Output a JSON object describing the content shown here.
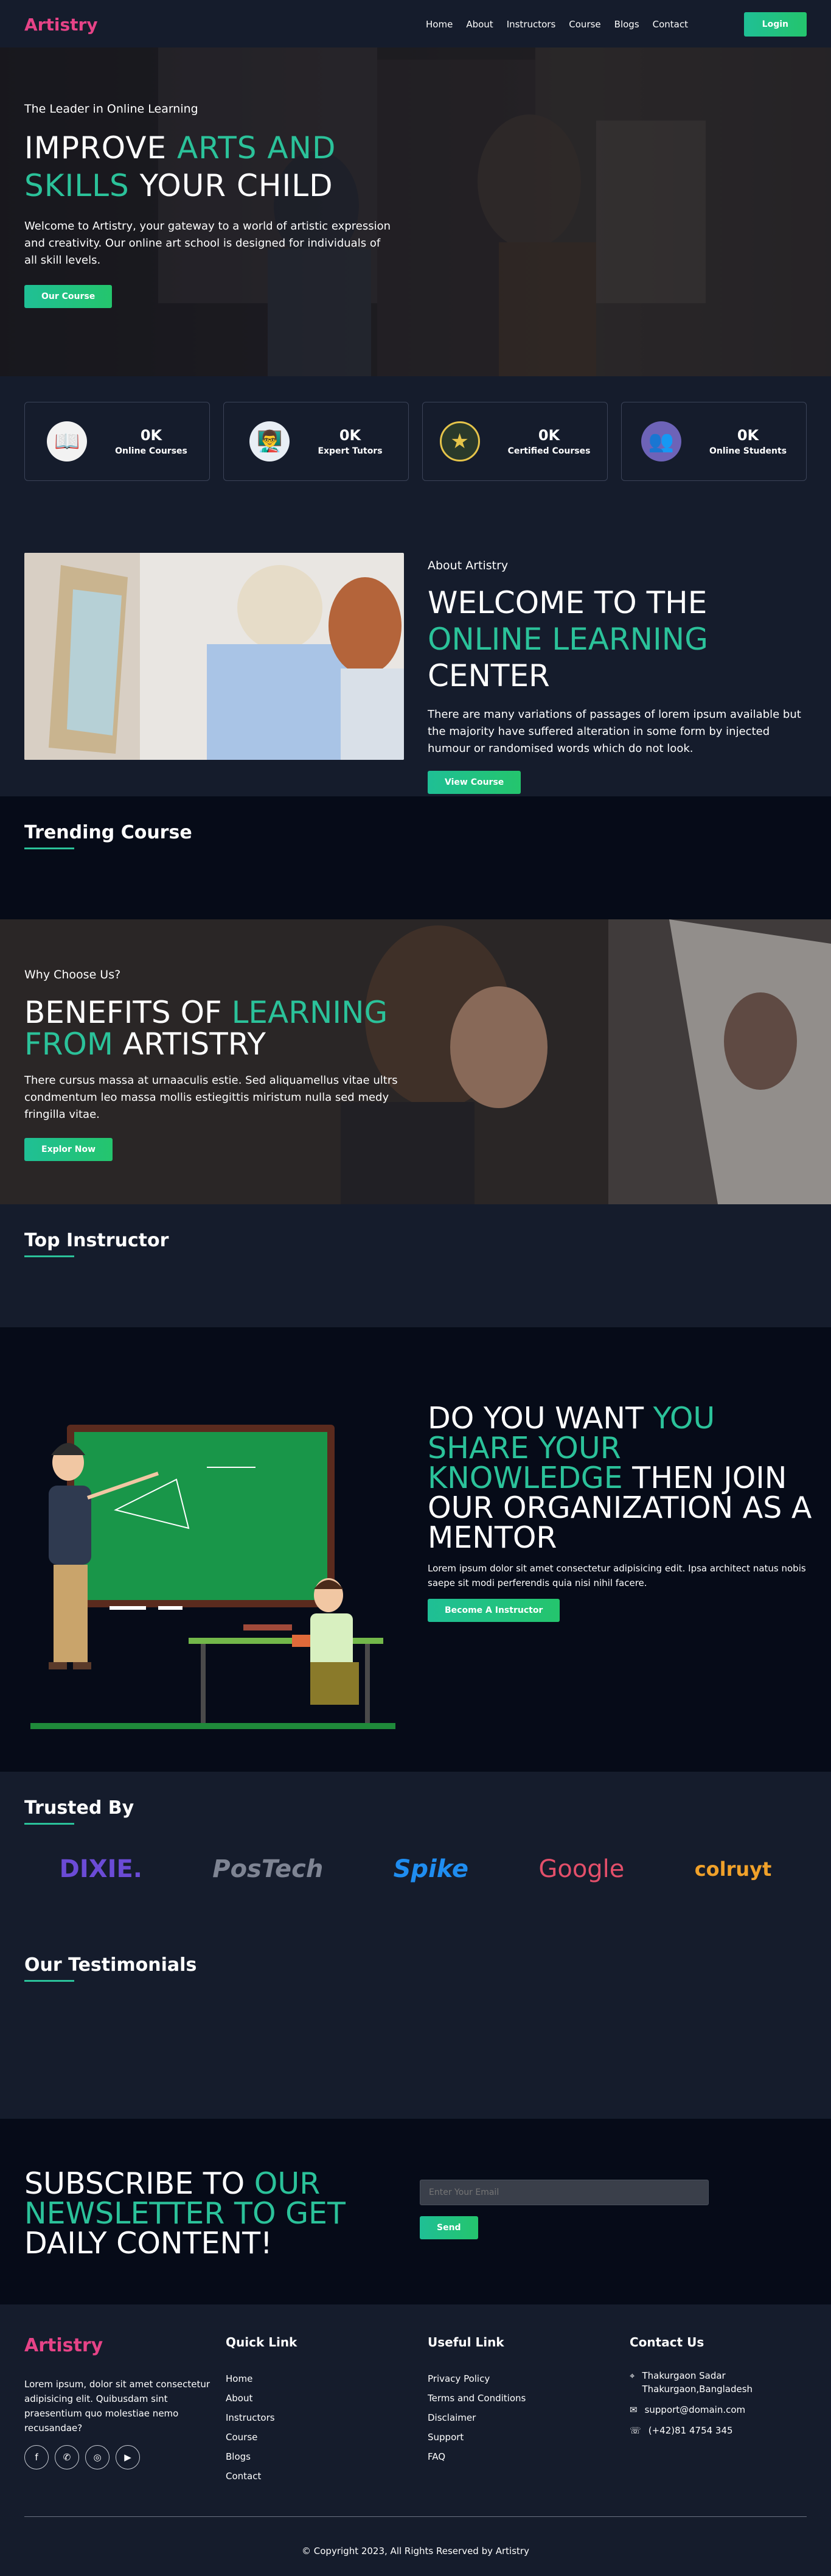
{
  "header": {
    "logo": "Artistry",
    "nav": [
      "Home",
      "About",
      "Instructors",
      "Course",
      "Blogs",
      "Contact"
    ],
    "login_label": "Login"
  },
  "hero": {
    "kicker": "The Leader in Online Learning",
    "title_a": "IMPROVE ",
    "title_b": "ARTS AND",
    "title_c": "SKILLS",
    "title_d": " YOUR CHILD",
    "text": "Welcome to Artistry, your gateway to a world of artistic expression and creativity. Our online art school is designed for individuals of all skill levels.",
    "button": "Our Course"
  },
  "stats": [
    {
      "icon": "book-icon",
      "value": "0K",
      "label": "Online Courses"
    },
    {
      "icon": "tutor-icon",
      "value": "0K",
      "label": "Expert Tutors"
    },
    {
      "icon": "certificate-icon",
      "value": "0K",
      "label": "Certified Courses"
    },
    {
      "icon": "students-icon",
      "value": "0K",
      "label": "Online Students"
    }
  ],
  "about": {
    "kicker": "About Artistry",
    "title_a": "WELCOME TO THE ",
    "title_b": "ONLINE LEARNING",
    "title_c": " CENTER",
    "text": "There are many variations of passages of lorem ipsum available but the majority have suffered alteration in some form by injected humour or randomised words which do not look.",
    "button": "View Course"
  },
  "trending": {
    "title": "Trending Course"
  },
  "benefits": {
    "kicker": "Why Choose Us?",
    "title_a": "BENEFITS OF ",
    "title_b": "LEARNING",
    "title_c": "FROM",
    "title_d": " ARTISTRY",
    "text": "There cursus massa at urnaaculis estie. Sed aliquamellus vitae ultrs condmentum leo massa mollis estiegittis miristum nulla sed medy fringilla vitae.",
    "button": "Explor Now"
  },
  "instructors": {
    "title": "Top Instructor"
  },
  "mentor": {
    "title_a": "DO YOU WANT ",
    "title_b": "YOU SHARE YOUR KNOWLEDGE",
    "title_c": " THEN JOIN OUR ORGANIZATION AS A MENTOR",
    "text": "Lorem ipsum dolor sit amet consectetur adipisicing edit. Ipsa architect natus nobis saepe sit modi perferendis quia nisi nihil facere.",
    "button": "Become A Instructor"
  },
  "trusted": {
    "title": "Trusted By",
    "logos": [
      {
        "name": "DIXIE.",
        "color": "#6b4bd6"
      },
      {
        "name": "PosTech",
        "color": "#7e8493"
      },
      {
        "name": "Spike",
        "color": "#1f8df0"
      },
      {
        "name": "Google",
        "color": "#e34f6a"
      },
      {
        "name": "colruyt",
        "color": "#f0a12a"
      }
    ]
  },
  "testimonials": {
    "title": "Our Testimonials"
  },
  "subscribe": {
    "title_a": "SUBSCRIBE TO ",
    "title_b": "OUR NEWSLETTER TO GET",
    "title_c": " DAILY CONTENT!",
    "placeholder": "Enter Your Email",
    "button": "Send"
  },
  "footer": {
    "logo": "Artistry",
    "about": "Lorem ipsum, dolor sit amet consectetur adipisicing elit. Quibusdam sint praesentium quo molestiae nemo recusandae?",
    "socials": [
      "f",
      "✆",
      "◎",
      "▶"
    ],
    "quick_title": "Quick Link",
    "quick_links": [
      "Home",
      "About",
      "Instructors",
      "Course",
      "Blogs",
      "Contact"
    ],
    "useful_title": "Useful Link",
    "useful_links": [
      "Privacy Policy",
      "Terms and Conditions",
      "Disclaimer",
      "Support",
      "FAQ"
    ],
    "contact_title": "Contact Us",
    "address": "Thakurgaon Sadar Thakurgaon,Bangladesh",
    "email": "support@domain.com",
    "phone": "(+42)81 4754 345",
    "copyright": "© Copyright 2023, All Rights Reserved by Artistry"
  },
  "colors": {
    "accent": "#2bc29a",
    "brand": "#e64387",
    "dark": "#151c2c",
    "darker": "#060b18"
  }
}
